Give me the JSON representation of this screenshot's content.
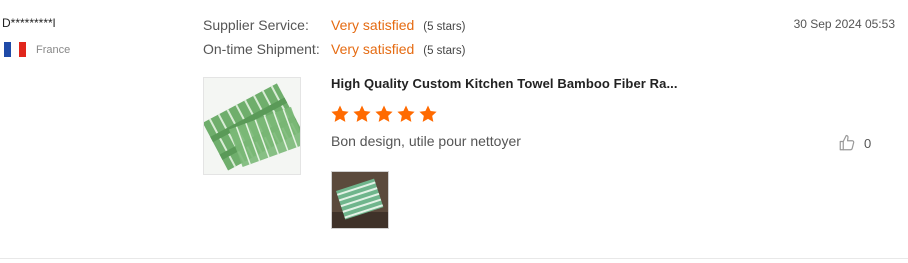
{
  "reviewer": {
    "name": "D*********l",
    "country": "France",
    "flag_icon": "flag-france-icon"
  },
  "ratings": [
    {
      "label": "Supplier Service:",
      "value": "Very satisfied",
      "stars": "(5 stars)"
    },
    {
      "label": "On-time Shipment:",
      "value": "Very satisfied",
      "stars": "(5 stars)"
    }
  ],
  "date": "30 Sep 2024 05:53",
  "product": {
    "title": "High Quality Custom Kitchen Towel Bamboo Fiber Ra...",
    "thumbnail_icon": "towel-product-image"
  },
  "review": {
    "rating": 5,
    "comment": "Bon design, utile pour nettoyer",
    "photo_icon": "review-photo-image"
  },
  "helpful": {
    "count": "0",
    "icon": "thumbs-up-icon"
  },
  "colors": {
    "accent": "#e56b12",
    "star": "#ff6a00"
  }
}
